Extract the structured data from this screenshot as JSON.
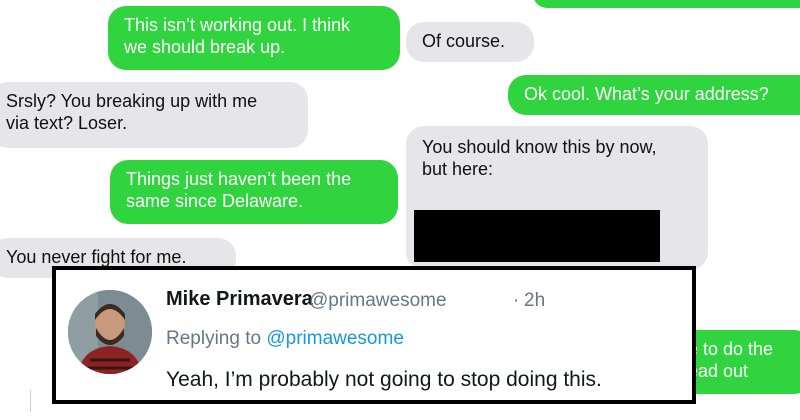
{
  "messages": {
    "m1": "This isn’t working out. I think",
    "m1b": "we should break up.",
    "m2": "Of course.",
    "m3": "Srsly? You breaking up with me",
    "m3b": "via text? Loser.",
    "m4": "Ok cool. What’s your address?",
    "m5": "You should know this by now,",
    "m5b": "but here:",
    "m6": "Things just haven’t been the",
    "m6b": "same since Delaware.",
    "m7": "You never fight for me.",
    "m8": "e to do the",
    "m8b": "ead out"
  },
  "tweet": {
    "name": "Mike Primavera",
    "handle": "@primawesome",
    "separator": "·",
    "time": "2h",
    "replying_prefix": "Replying to",
    "replying_handle": "@primawesome",
    "text": "Yeah, I’m probably not going to stop doing this."
  },
  "colors": {
    "sent_bubble": "#2fd43e",
    "received_bubble": "#e5e5ea",
    "mention_blue": "#1b95e0"
  }
}
